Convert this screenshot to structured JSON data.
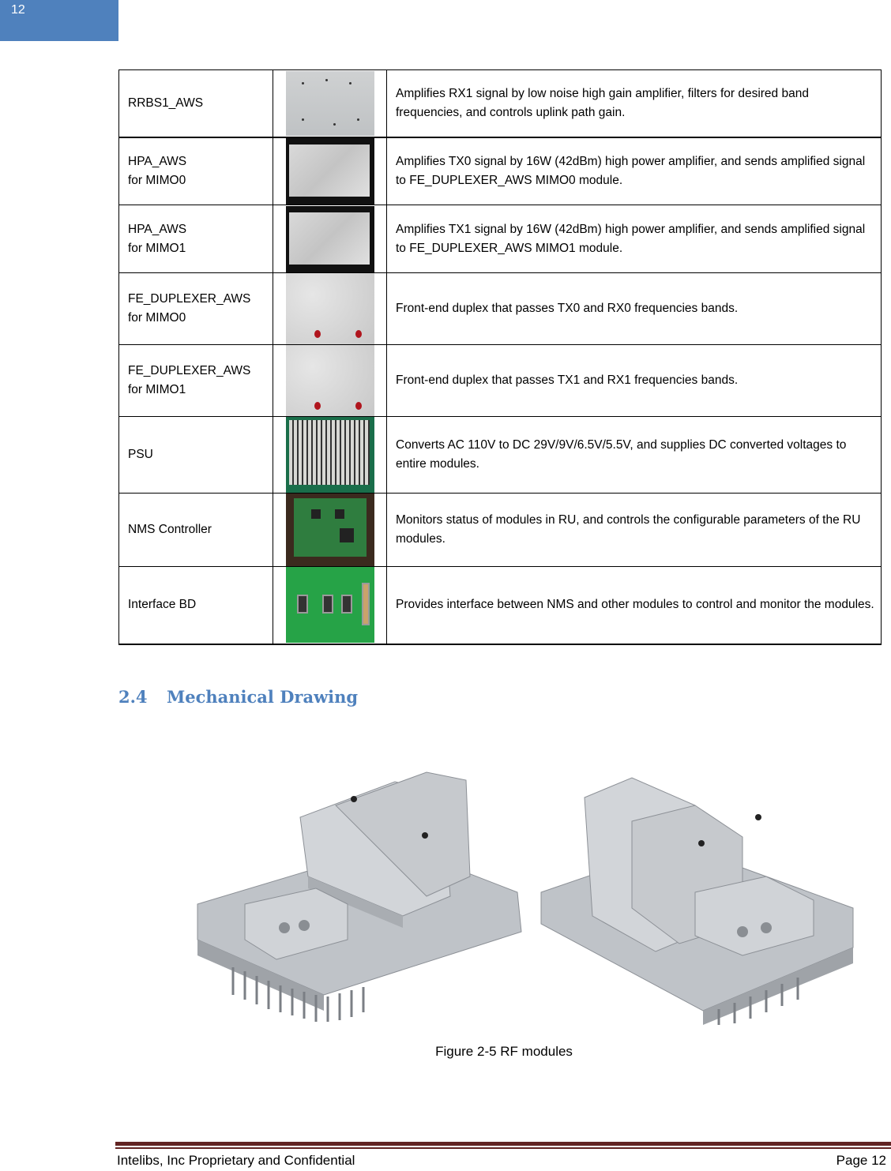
{
  "page_tab": {
    "number": "12"
  },
  "module_table": {
    "rows": [
      {
        "name_line1": "RRBS1_AWS",
        "name_line2": "",
        "photo": "rrbs1-aws-module-photo",
        "description": "Amplifies RX1 signal by low noise high gain amplifier, filters for desired band frequencies, and controls uplink path gain."
      },
      {
        "name_line1": "HPA_AWS",
        "name_line2": "for MIMO0",
        "photo": "hpa-aws-module-photo",
        "description": "Amplifies TX0 signal by 16W (42dBm) high power amplifier, and sends amplified signal to FE_DUPLEXER_AWS MIMO0 module."
      },
      {
        "name_line1": "HPA_AWS",
        "name_line2": "for MIMO1",
        "photo": "hpa-aws-module-photo",
        "description": "Amplifies TX1 signal by 16W (42dBm) high power amplifier, and sends amplified signal to FE_DUPLEXER_AWS MIMO1 module."
      },
      {
        "name_line1": "FE_DUPLEXER_AWS",
        "name_line2": "for MIMO0",
        "photo": "duplexer-module-photo",
        "description": "Front-end duplex that passes TX0 and RX0 frequencies bands."
      },
      {
        "name_line1": "FE_DUPLEXER_AWS",
        "name_line2": "for MIMO1",
        "photo": "duplexer-module-photo",
        "description": "Front-end duplex that passes TX1 and RX1 frequencies bands."
      },
      {
        "name_line1": "PSU",
        "name_line2": "",
        "photo": "psu-module-photo",
        "description": "Converts AC 110V to DC 29V/9V/6.5V/5.5V, and supplies DC converted voltages to entire modules."
      },
      {
        "name_line1": "NMS Controller",
        "name_line2": "",
        "photo": "nms-controller-photo",
        "description": "Monitors status of modules in RU, and controls the configurable parameters of the RU modules."
      },
      {
        "name_line1": "Interface BD",
        "name_line2": "",
        "photo": "interface-board-photo",
        "description": "Provides interface between NMS and other modules to control and monitor the modules."
      }
    ]
  },
  "section": {
    "number": "2.4",
    "title": "Mechanical Drawing"
  },
  "figure": {
    "caption": "Figure 2-5 RF modules",
    "image": "rf-modules-mechanical-drawing"
  },
  "footer": {
    "left": "Intelibs, Inc Proprietary and Confidential",
    "right": "Page 12"
  },
  "colors": {
    "accent_blue": "#4f81bd",
    "footer_rule": "#622423"
  }
}
